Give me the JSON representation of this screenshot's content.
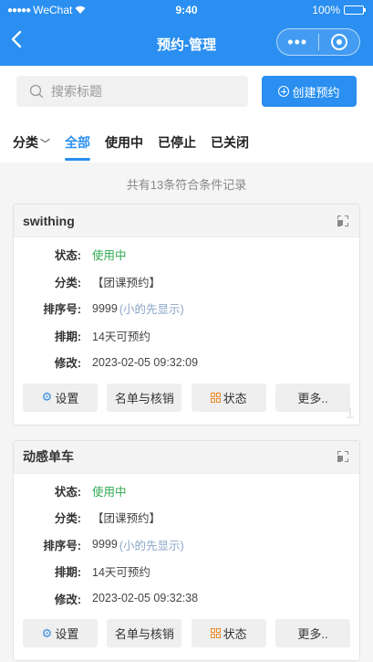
{
  "status_bar": {
    "carrier": "WeChat",
    "time": "9:40",
    "battery": "100%"
  },
  "nav": {
    "back_icon": "chevron-left-icon",
    "title": "预约-管理"
  },
  "search": {
    "placeholder": "搜索标题"
  },
  "create_button": {
    "label": "创建预约"
  },
  "tabs": [
    {
      "label": "分类"
    },
    {
      "label": "全部"
    },
    {
      "label": "使用中"
    },
    {
      "label": "已停止"
    },
    {
      "label": "已关闭"
    }
  ],
  "summary": "共有13条符合条件记录",
  "labels": {
    "status": "状态:",
    "category": "分类:",
    "sort": "排序号:",
    "schedule": "排期:",
    "modified": "修改:"
  },
  "buttons": {
    "settings": "设置",
    "list": "名单与核销",
    "status": "状态",
    "more": "更多.."
  },
  "cards": [
    {
      "title": "swithing",
      "status": "使用中",
      "category": "【团课预约】",
      "sort": "9999",
      "sort_hint": "(小的先显示)",
      "schedule": "14天可预约",
      "modified": "2023-02-05 09:32:09",
      "index": "1"
    },
    {
      "title": "动感单车",
      "status": "使用中",
      "category": "【团课预约】",
      "sort": "9999",
      "sort_hint": "(小的先显示)",
      "schedule": "14天可预约",
      "modified": "2023-02-05 09:32:38"
    }
  ],
  "colors": {
    "brand": "#2a8ff0",
    "status_active": "#2ca94f",
    "hint": "#8aa5c9"
  }
}
